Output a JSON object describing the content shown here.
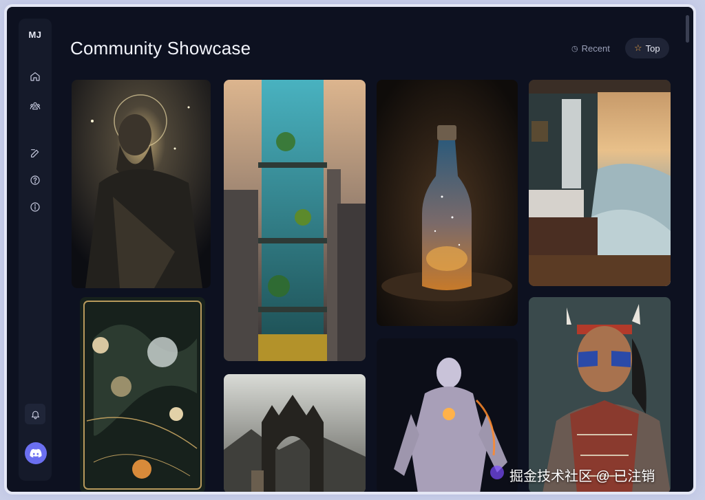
{
  "sidebar": {
    "logo": "MJ",
    "items": [
      {
        "icon": "home-icon"
      },
      {
        "icon": "community-icon"
      },
      {
        "icon": "edit-icon"
      },
      {
        "icon": "help-icon"
      },
      {
        "icon": "info-icon"
      }
    ],
    "bottom": [
      {
        "icon": "bell-icon"
      },
      {
        "icon": "discord-icon"
      }
    ]
  },
  "header": {
    "title": "Community Showcase",
    "sort": {
      "recent_label": "Recent",
      "top_label": "Top",
      "selected": "Top"
    }
  },
  "gallery": {
    "items": [
      {
        "subject": "bearded-deity-statue"
      },
      {
        "subject": "aquarium-tower-city"
      },
      {
        "subject": "galaxy-in-bottle"
      },
      {
        "subject": "ocean-bedroom"
      },
      {
        "subject": "ornate-fantasy-map"
      },
      {
        "subject": "ruined-gothic-arch"
      },
      {
        "subject": "glowing-ghost-armor"
      },
      {
        "subject": "native-elder-portrait"
      }
    ]
  },
  "watermark": "掘金技术社区 @ 已注销",
  "colors": {
    "background": "#0d1120",
    "sidebar": "#151a2a",
    "accent_star": "#f0a642",
    "discord": "#6b6ff0"
  }
}
